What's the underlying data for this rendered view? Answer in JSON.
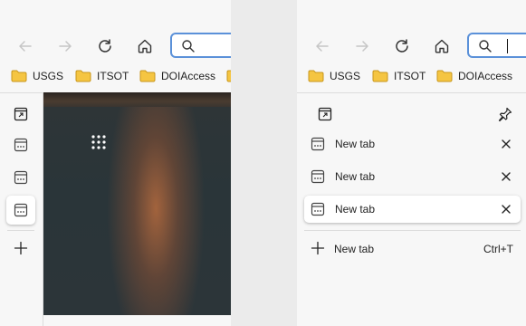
{
  "bookmarks": [
    "USGS",
    "ITSOT",
    "DOIAccess"
  ],
  "left_pane": {
    "sidebar_tabs": 3,
    "new_tab_icon": "plus-icon"
  },
  "right_pane": {
    "tabs": [
      {
        "label": "New tab",
        "active": false
      },
      {
        "label": "New tab",
        "active": false
      },
      {
        "label": "New tab",
        "active": true
      }
    ],
    "new_tab": {
      "label": "New tab",
      "shortcut": "Ctrl+T"
    }
  },
  "icons": {
    "back": "arrow-left-icon",
    "forward": "arrow-right-icon",
    "refresh": "refresh-icon",
    "home": "home-icon",
    "search": "search-icon",
    "folder": "folder-icon",
    "pin": "pin-icon",
    "close": "close-icon",
    "tab_actions": "tab-actions-icon"
  },
  "colors": {
    "accent": "#5b91d9",
    "folder": "#f5c542",
    "chrome_bg": "#f7f7f7"
  }
}
